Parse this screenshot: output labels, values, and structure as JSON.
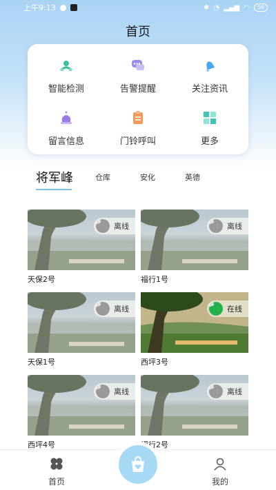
{
  "status_bar": {
    "time": "上午9:13",
    "battery": "56"
  },
  "header": {
    "title": "首页"
  },
  "functions": [
    {
      "label": "智能检测",
      "icon": "smart-detect-icon",
      "color": "#3bbf9a"
    },
    {
      "label": "告警提醒",
      "icon": "alarm-chat-icon",
      "color": "#9b8cf0"
    },
    {
      "label": "关注资讯",
      "icon": "bell-icon",
      "color": "#4aa8f0"
    },
    {
      "label": "留言信息",
      "icon": "siren-icon",
      "color": "#9b7be6"
    },
    {
      "label": "门铃呼叫",
      "icon": "doorbell-note-icon",
      "color": "#f39a56"
    },
    {
      "label": "更多",
      "icon": "grid-more-icon",
      "color": "#3cc7b4"
    }
  ],
  "tabs": [
    "将军峰",
    "仓库",
    "安化",
    "英德"
  ],
  "cameras": [
    {
      "name": "天保2号",
      "status": "离线",
      "online": false
    },
    {
      "name": "福行1号",
      "status": "离线",
      "online": false
    },
    {
      "name": "天保1号",
      "status": "离线",
      "online": false
    },
    {
      "name": "西坪3号",
      "status": "在线",
      "online": true
    },
    {
      "name": "西坪4号",
      "status": "离线",
      "online": false
    },
    {
      "name": "福行2号",
      "status": "离线",
      "online": false
    }
  ],
  "bottom_nav": {
    "home": "首页",
    "mine": "我的"
  }
}
